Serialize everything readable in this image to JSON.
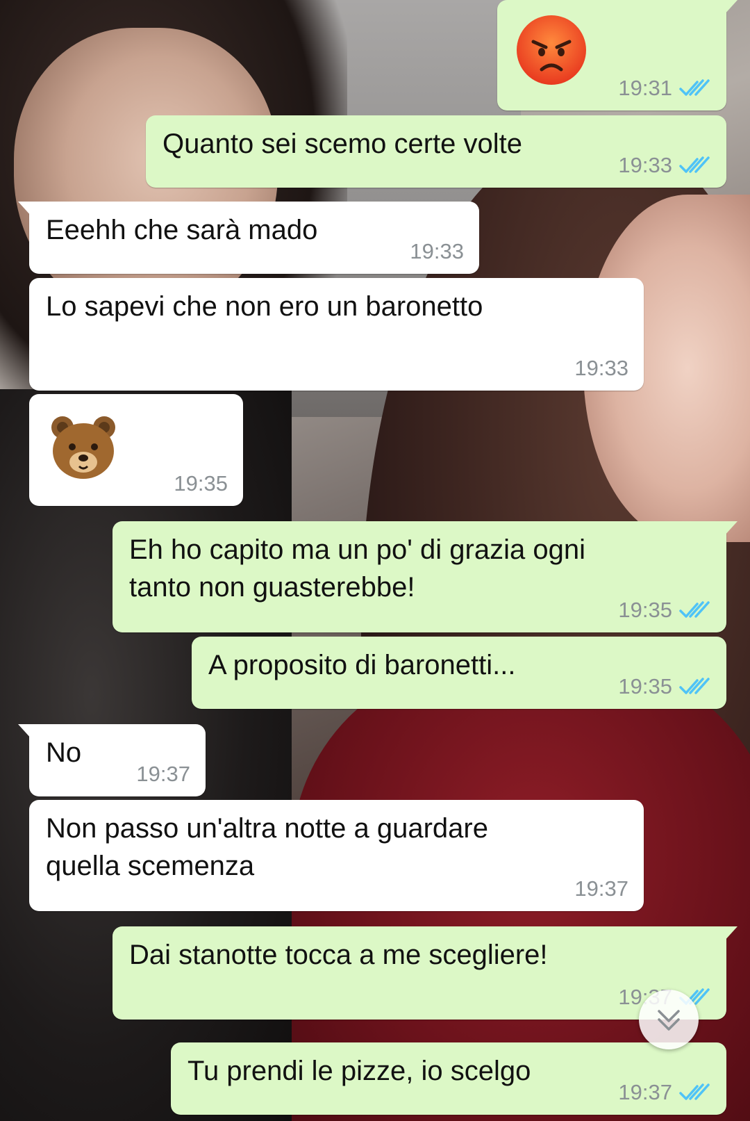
{
  "messages": [
    {
      "direction": "out",
      "emoji": "angry-face",
      "time": "19:31",
      "status": "read"
    },
    {
      "direction": "out",
      "text": "Quanto sei scemo certe volte",
      "time": "19:33",
      "status": "read"
    },
    {
      "direction": "in",
      "text": "Eeehh che sarà mado",
      "time": "19:33"
    },
    {
      "direction": "in",
      "text": "Lo sapevi che non ero un baronetto",
      "time": "19:33"
    },
    {
      "direction": "in",
      "emoji": "bear-face",
      "time": "19:35"
    },
    {
      "direction": "out",
      "text": "Eh ho capito ma un po' di grazia ogni tanto non guasterebbe!",
      "time": "19:35",
      "status": "read"
    },
    {
      "direction": "out",
      "text": "A proposito di baronetti...",
      "time": "19:35",
      "status": "read"
    },
    {
      "direction": "in",
      "text": "No",
      "time": "19:37"
    },
    {
      "direction": "in",
      "text": "Non passo un'altra notte a guardare quella scemenza",
      "time": "19:37"
    },
    {
      "direction": "out",
      "text": "Dai stanotte tocca a me scegliere!",
      "time": "19:37",
      "status": "read"
    },
    {
      "direction": "out",
      "text": "Tu prendi le pizze, io scelgo",
      "time": "19:37",
      "status": "read"
    }
  ],
  "scroll_button": {
    "icon": "double-chevron-down-icon"
  },
  "colors": {
    "outgoing_bubble": "#dcf8c6",
    "incoming_bubble": "#ffffff",
    "read_ticks": "#4fc3f7",
    "meta_text": "#8a9094"
  }
}
